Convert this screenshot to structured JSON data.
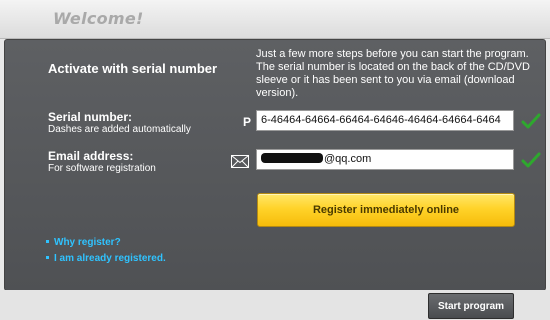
{
  "window": {
    "title": "Welcome!"
  },
  "panel": {
    "heading": "Activate with serial number",
    "intro": "Just a few more steps before you can start the program. The serial number is located on the back of the CD/DVD sleeve or it has been sent to you via email (download version)."
  },
  "serial": {
    "label": "Serial number:",
    "hint": "Dashes are added automatically",
    "prefix_icon_text": "P",
    "value": "6-46464-64664-66464-64646-46464-64664-6464",
    "status_icon": "checkmark-icon"
  },
  "email": {
    "label": "Email address:",
    "hint": "For software registration",
    "prefix_icon": "envelope-icon",
    "value_visible": "@qq.com",
    "status_icon": "checkmark-icon"
  },
  "register": {
    "label": "Register immediately online"
  },
  "links": [
    {
      "label": "Why register?"
    },
    {
      "label": "I am already registered."
    }
  ],
  "footer": {
    "start_label": "Start program"
  },
  "colors": {
    "panel_bg": "#55575a",
    "accent_link": "#2fc3ff",
    "check_green": "#2ea82e",
    "register_yellow": "#ffd32a"
  }
}
